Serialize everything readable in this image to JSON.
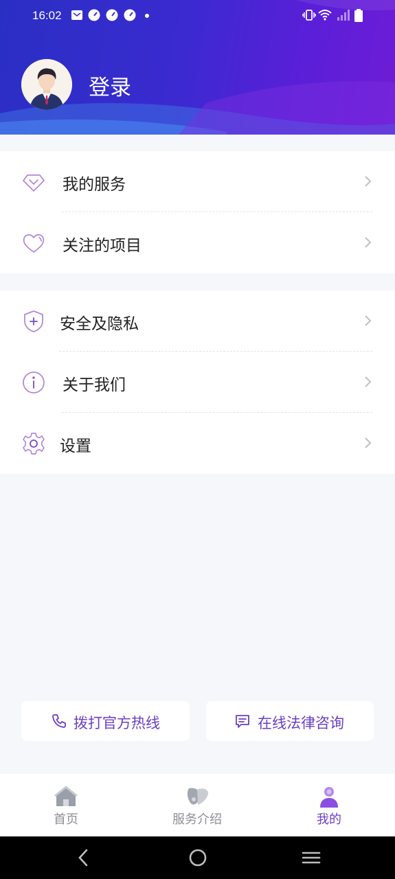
{
  "status_bar": {
    "time": "16:02",
    "left_icons": [
      "mail-icon",
      "gauge-icon",
      "gauge-icon",
      "gauge-icon",
      "dot-icon"
    ],
    "right_icons": [
      "vibrate-icon",
      "wifi-icon",
      "signal-icon",
      "battery-icon"
    ]
  },
  "header": {
    "login_label": "登录",
    "gradient_start": "#2a2fc4",
    "gradient_end": "#6f1cd6"
  },
  "menu_group_1": [
    {
      "label": "我的服务",
      "icon": "diamond-icon"
    },
    {
      "label": "关注的项目",
      "icon": "heart-icon"
    }
  ],
  "menu_group_2": [
    {
      "label": "安全及隐私",
      "icon": "shield-plus-icon"
    },
    {
      "label": "关于我们",
      "icon": "info-icon"
    },
    {
      "label": "设置",
      "icon": "gear-icon"
    }
  ],
  "actions": {
    "hotline_label": "拨打官方热线",
    "consult_label": "在线法律咨询"
  },
  "tabs": [
    {
      "label": "首页",
      "icon": "home-icon",
      "active": false
    },
    {
      "label": "服务介绍",
      "icon": "service-icon",
      "active": false
    },
    {
      "label": "我的",
      "icon": "profile-icon",
      "active": true
    }
  ],
  "colors": {
    "accent": "#6a3fc4",
    "icon_stroke": "#b48ad8",
    "tab_inactive": "#8e8e95"
  },
  "system_nav": [
    "back-icon",
    "home-circle-icon",
    "recents-icon"
  ]
}
